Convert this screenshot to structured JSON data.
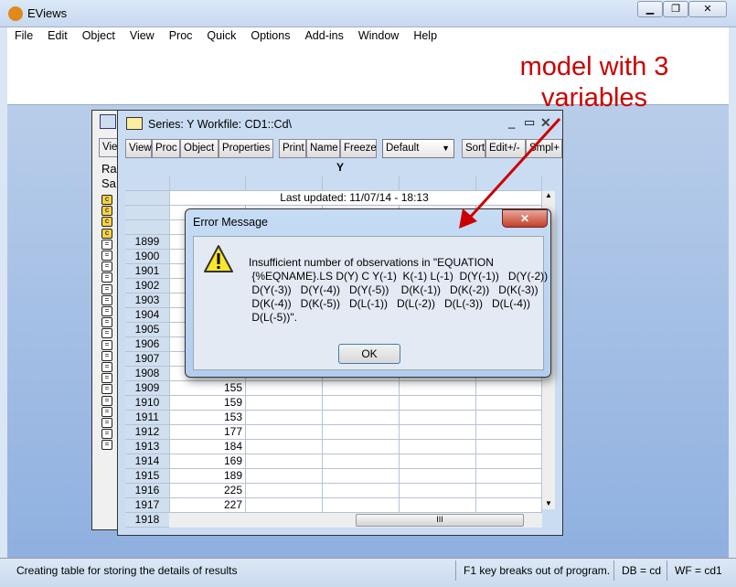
{
  "app": {
    "title": "EViews",
    "menu": [
      "File",
      "Edit",
      "Object",
      "View",
      "Proc",
      "Quick",
      "Options",
      "Add-ins",
      "Window",
      "Help"
    ]
  },
  "workfile_window": {
    "toolbar_partial": "Vie",
    "labels": [
      "Ra",
      "Sa"
    ]
  },
  "series_window": {
    "title": "Series: Y   Workfile: CD1::Cd\\",
    "toolbar": [
      "View",
      "Proc",
      "Object",
      "Properties",
      "Print",
      "Name",
      "Freeze",
      "Sort",
      "Edit+/-",
      "Smpl+"
    ],
    "display_select": "Default",
    "column_header": "Y",
    "last_updated": "Last updated: 11/07/14 - 18:13",
    "rows": [
      {
        "year": "1899",
        "value": ""
      },
      {
        "year": "1900",
        "value": ""
      },
      {
        "year": "1901",
        "value": ""
      },
      {
        "year": "1902",
        "value": ""
      },
      {
        "year": "1903",
        "value": ""
      },
      {
        "year": "1904",
        "value": ""
      },
      {
        "year": "1905",
        "value": ""
      },
      {
        "year": "1906",
        "value": ""
      },
      {
        "year": "1907",
        "value": ""
      },
      {
        "year": "1908",
        "value": ""
      },
      {
        "year": "1909",
        "value": "155"
      },
      {
        "year": "1910",
        "value": "159"
      },
      {
        "year": "1911",
        "value": "153"
      },
      {
        "year": "1912",
        "value": "177"
      },
      {
        "year": "1913",
        "value": "184"
      },
      {
        "year": "1914",
        "value": "169"
      },
      {
        "year": "1915",
        "value": "189"
      },
      {
        "year": "1916",
        "value": "225"
      },
      {
        "year": "1917",
        "value": "227"
      },
      {
        "year": "1918",
        "value": ""
      }
    ]
  },
  "dialog": {
    "title": "Error Message",
    "icon": "warning-icon",
    "message": "Insufficient number of observations in \"EQUATION\n {%EQNAME}.LS D(Y) C Y(-1)  K(-1) L(-1)  D(Y(-1))   D(Y(-2))\n D(Y(-3))   D(Y(-4))   D(Y(-5))    D(K(-1))   D(K(-2))   D(K(-3))\n D(K(-4))   D(K(-5))   D(L(-1))   D(L(-2))   D(L(-3))   D(L(-4))\n D(L(-5))\".",
    "ok": "OK"
  },
  "annotation": {
    "line1": "model with 3",
    "line2": "variables",
    "color": "#cc0000"
  },
  "status": {
    "message": "Creating table for storing the details of results",
    "hint": "F1 key breaks out of program.",
    "db": "DB = cd",
    "wf": "WF = cd1"
  }
}
